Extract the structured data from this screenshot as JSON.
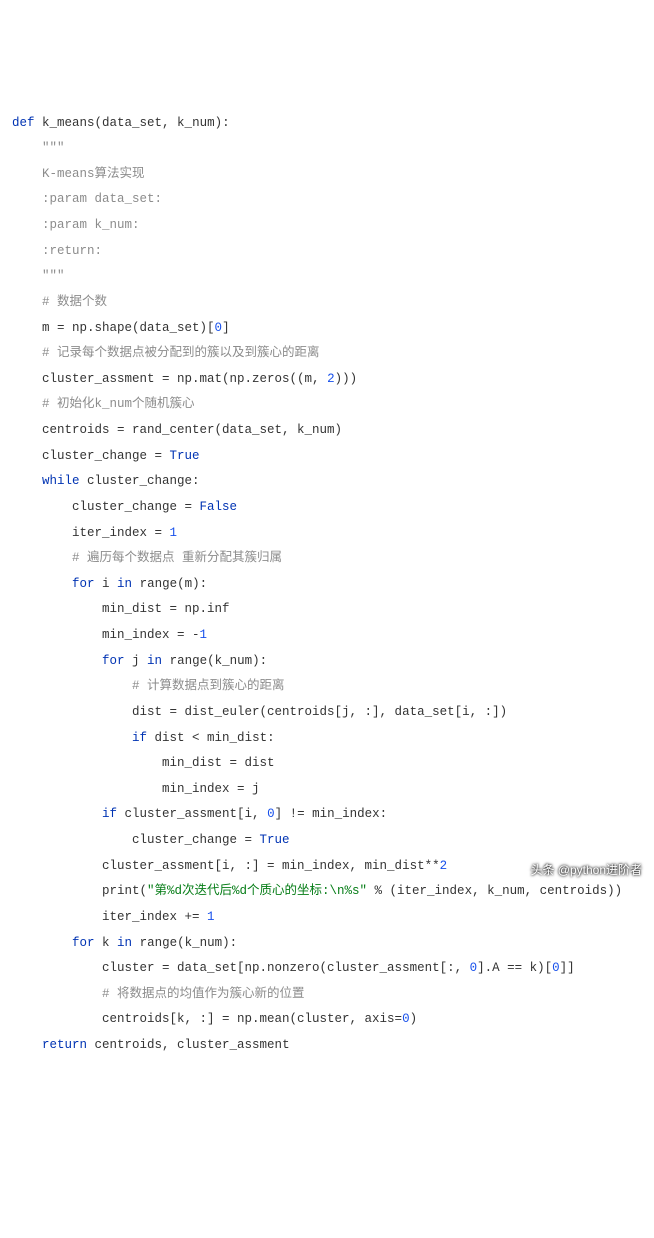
{
  "code": {
    "line1": {
      "def": "def",
      "fn": "k_means",
      "params": "(data_set, k_num):"
    },
    "line2": "    \"\"\"",
    "line3": "    K-means算法实现",
    "line4": "    :param data_set:",
    "line5": "    :param k_num:",
    "line6": "    :return:",
    "line7": "    \"\"\"",
    "line8_cm": "    # 数据个数",
    "line9_a": "    m = np.shape(data_set)[",
    "line9_num": "0",
    "line9_b": "]",
    "line10_cm": "    # 记录每个数据点被分配到的簇以及到簇心的距离",
    "line11_a": "    cluster_assment = np.mat(np.zeros((m, ",
    "line11_num": "2",
    "line11_b": ")))",
    "line12_cm": "    # 初始化k_num个随机簇心",
    "line13": "    centroids = rand_center(data_set, k_num)",
    "line14_a": "    cluster_change = ",
    "line14_b": "True",
    "line15_a": "    ",
    "line15_kw": "while",
    "line15_b": " cluster_change:",
    "line16_a": "        cluster_change = ",
    "line16_b": "False",
    "line17_a": "        iter_index = ",
    "line17_num": "1",
    "line18_cm": "        # 遍历每个数据点 重新分配其簇归属",
    "line19_a": "        ",
    "line19_for": "for",
    "line19_b": " i ",
    "line19_in": "in",
    "line19_c": " range(m):",
    "line20": "            min_dist = np.inf",
    "line21_a": "            min_index = -",
    "line21_num": "1",
    "line22_a": "            ",
    "line22_for": "for",
    "line22_b": " j ",
    "line22_in": "in",
    "line22_c": " range(k_num):",
    "line23_cm": "                # 计算数据点到簇心的距离",
    "line24": "                dist = dist_euler(centroids[j, :], data_set[i, :])",
    "line25_a": "                ",
    "line25_if": "if",
    "line25_b": " dist < min_dist:",
    "line26": "                    min_dist = dist",
    "line27": "                    min_index = j",
    "line28_a": "            ",
    "line28_if": "if",
    "line28_b": " cluster_assment[i, ",
    "line28_num": "0",
    "line28_c": "] != min_index:",
    "line29_a": "                cluster_change = ",
    "line29_b": "True",
    "line30_a": "            cluster_assment[i, :] = min_index, min_dist**",
    "line30_num": "2",
    "line31_a": "            print(",
    "line31_str": "\"第%d次迭代后%d个质心的坐标:\\n%s\"",
    "line31_b": " % (iter_index, k_num, centroids))",
    "line32_a": "            iter_index += ",
    "line32_num": "1",
    "line33_a": "        ",
    "line33_for": "for",
    "line33_b": " k ",
    "line33_in": "in",
    "line33_c": " range(k_num):",
    "line34_a": "            cluster = data_set[np.nonzero(cluster_assment[:, ",
    "line34_n1": "0",
    "line34_b": "].A == k)[",
    "line34_n2": "0",
    "line34_c": "]]",
    "line35_cm": "            # 将数据点的均值作为簇心新的位置",
    "line36_a": "            centroids[k, :] = np.mean(cluster, axis=",
    "line36_num": "0",
    "line36_b": ")",
    "line37_a": "    ",
    "line37_kw": "return",
    "line37_b": " centroids, cluster_assment"
  },
  "watermark": "头条 @python进阶者"
}
